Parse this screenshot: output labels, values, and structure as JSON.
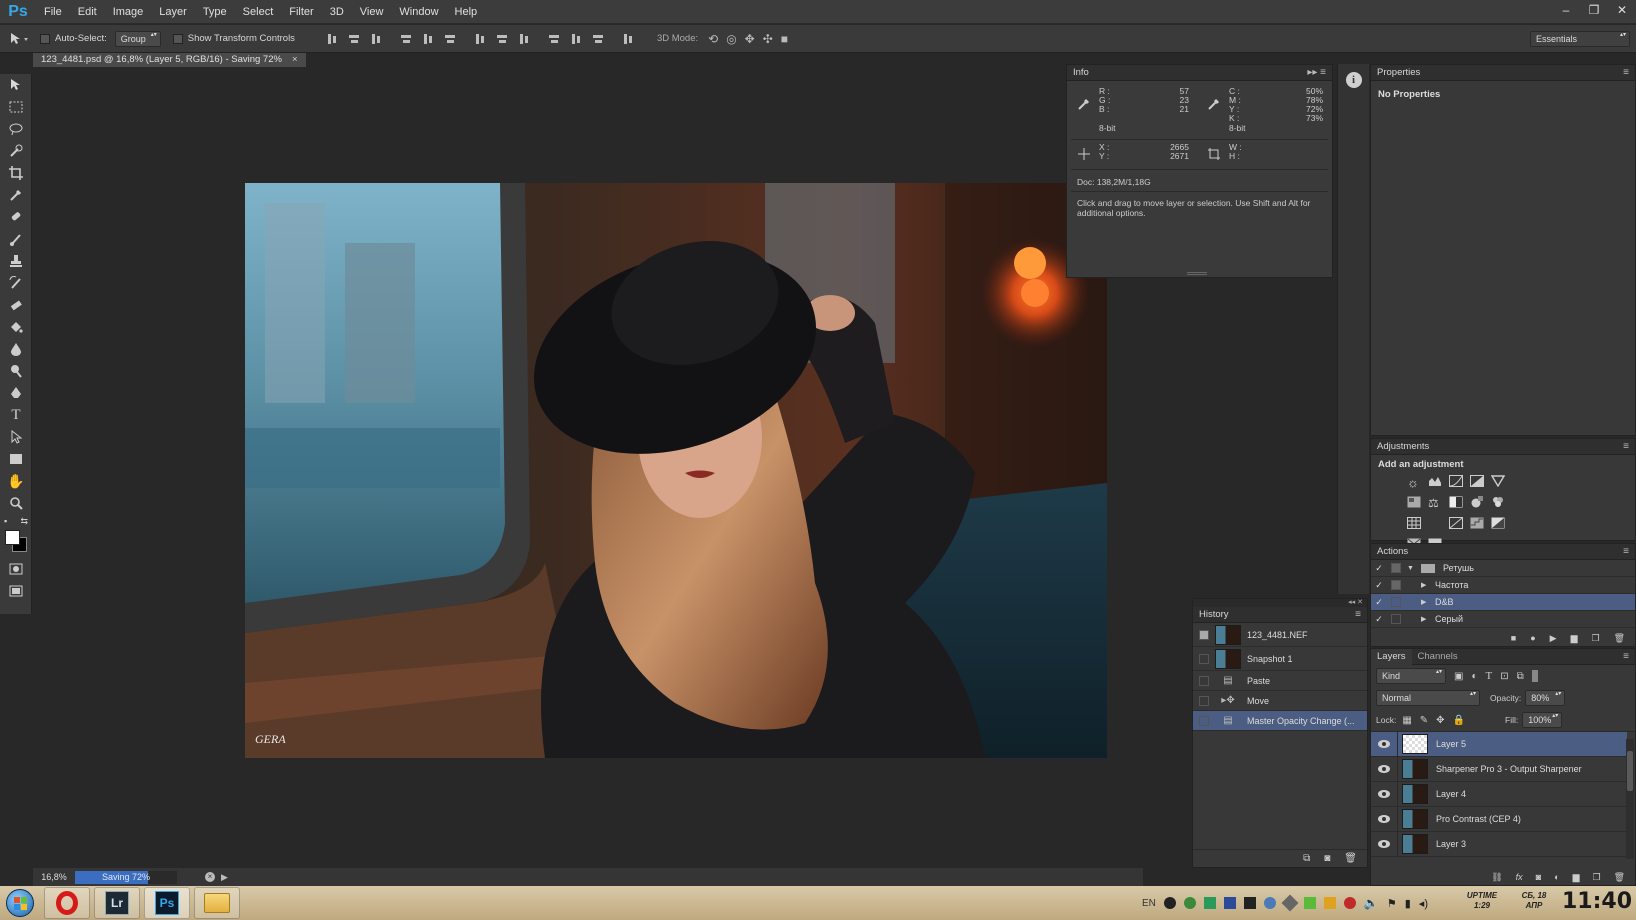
{
  "app": {
    "logo": "Ps",
    "brand_color": "#36a7e9"
  },
  "menu": [
    "File",
    "Edit",
    "Image",
    "Layer",
    "Type",
    "Select",
    "Filter",
    "3D",
    "View",
    "Window",
    "Help"
  ],
  "window_controls": [
    "–",
    "❐",
    "✕"
  ],
  "options_bar": {
    "auto_select_label": "Auto-Select:",
    "auto_select_value": "Group",
    "transform_label": "Show Transform Controls",
    "mode_3d_label": "3D Mode:",
    "workspace": "Essentials"
  },
  "document": {
    "tab_title": "123_4481.psd @ 16,8% (Layer 5, RGB/16) - Saving 72%",
    "close": "×",
    "watermark": "GERA"
  },
  "status": {
    "zoom": "16,8%",
    "progress_label": "Saving 72%",
    "progress": 0.72
  },
  "info_panel": {
    "title": "Info",
    "r_label": "R :",
    "r": "57",
    "g_label": "G :",
    "g": "23",
    "b_label": "B :",
    "b": "21",
    "bit_left": "8-bit",
    "c_label": "C :",
    "c": "50%",
    "m_label": "M :",
    "m": "78%",
    "y_label": "Y :",
    "y": "72%",
    "k_label": "K :",
    "k": "73%",
    "bit_right": "8-bit",
    "x_label": "X :",
    "x": "2665",
    "y2_label": "Y :",
    "y2": "2671",
    "w_label": "W :",
    "h_label": "H :",
    "doc": "Doc: 138,2M/1,18G",
    "hint": "Click and drag to move layer or selection.  Use Shift and Alt for additional options."
  },
  "properties_panel": {
    "title": "Properties",
    "message": "No Properties"
  },
  "adjustments_panel": {
    "title": "Adjustments",
    "subtitle": "Add an adjustment"
  },
  "actions_panel": {
    "title": "Actions",
    "items": [
      {
        "label": "Ретушь",
        "type": "set"
      },
      {
        "label": "Частота",
        "type": "action"
      },
      {
        "label": "D&B",
        "type": "action",
        "selected": true
      },
      {
        "label": "Серый",
        "type": "action"
      }
    ]
  },
  "history_panel": {
    "title": "History",
    "items": [
      {
        "label": "123_4481.NEF",
        "kind": "snapshot"
      },
      {
        "label": "Snapshot 1",
        "kind": "snapshot"
      },
      {
        "label": "Paste",
        "kind": "step"
      },
      {
        "label": "Move",
        "kind": "step"
      },
      {
        "label": "Master Opacity Change (...",
        "kind": "step",
        "selected": true
      }
    ]
  },
  "layers_panel": {
    "tabs": [
      "Layers",
      "Channels"
    ],
    "filter": "Kind",
    "blend_mode": "Normal",
    "opacity_label": "Opacity:",
    "opacity": "80%",
    "lock_label": "Lock:",
    "fill_label": "Fill:",
    "fill": "100%",
    "layers": [
      {
        "name": "Layer 5",
        "selected": true,
        "transparent": true
      },
      {
        "name": "Sharpener Pro 3 - Output Sharpener"
      },
      {
        "name": "Layer 4"
      },
      {
        "name": "Pro Contrast (CEP 4)"
      },
      {
        "name": "Layer 3"
      }
    ]
  },
  "taskbar": {
    "apps": [
      "Opera",
      "Lr",
      "Ps",
      "Explorer"
    ],
    "lang": "EN",
    "uptime_label": "UPTIME",
    "uptime": "1:29",
    "date_line1": "СБ, 18",
    "date_line2": "АПР",
    "time": "11:40"
  },
  "colors": {
    "accent_selected": "#4b5d82",
    "panel_bg": "#383838",
    "progress_fill": "#3b6ec0"
  }
}
